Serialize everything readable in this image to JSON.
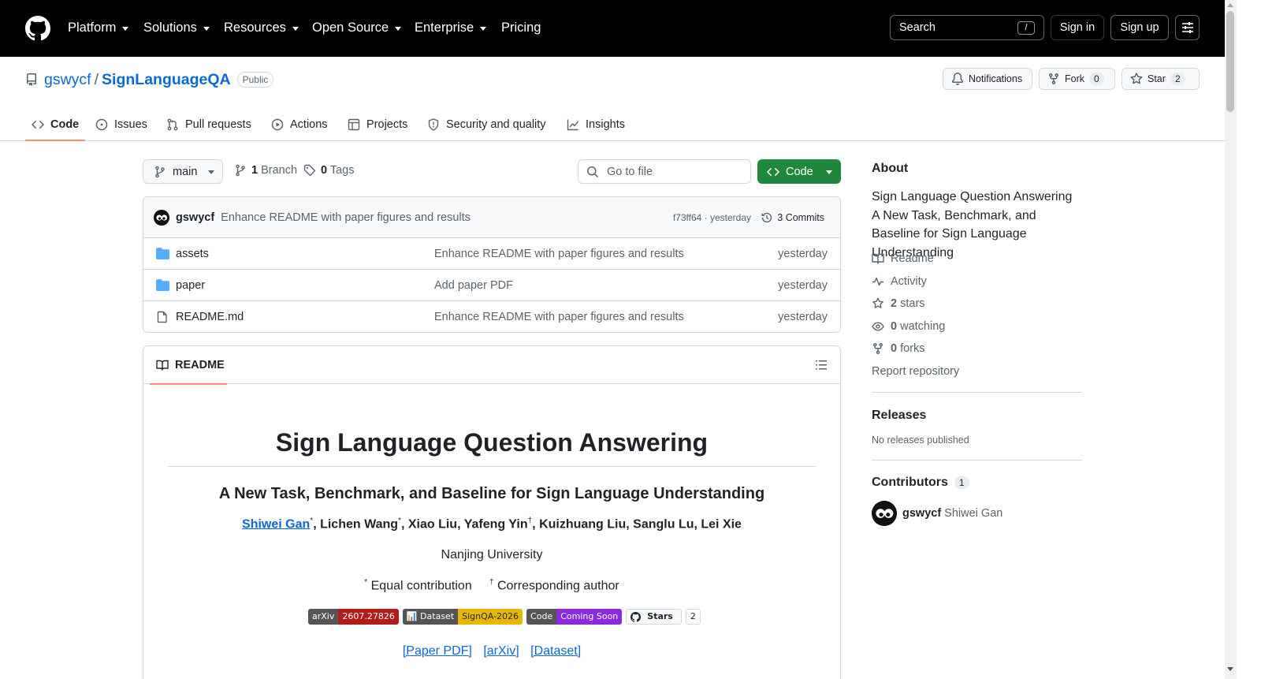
{
  "header": {
    "nav": [
      "Platform",
      "Solutions",
      "Resources",
      "Open Source",
      "Enterprise",
      "Pricing"
    ],
    "search_label": "Search",
    "search_key": "/",
    "sign_in": "Sign in",
    "sign_up": "Sign up"
  },
  "repo": {
    "owner": "gswycf",
    "separator": "/",
    "name": "SignLanguageQA",
    "visibility": "Public",
    "notifications_label": "Notifications",
    "fork_label": "Fork",
    "fork_count": "0",
    "star_label": "Star",
    "star_count": "2"
  },
  "tabs": [
    "Code",
    "Issues",
    "Pull requests",
    "Actions",
    "Projects",
    "Security and quality",
    "Insights"
  ],
  "toolbar": {
    "branch": "main",
    "branch_count": "1",
    "branch_label": "Branch",
    "tag_count": "0",
    "tag_label": "Tags",
    "goto_placeholder": "Go to file",
    "code_button": "Code"
  },
  "latest_commit": {
    "author": "gswycf",
    "message": "Enhance README with paper figures and results",
    "meta": "f73ff64 · yesterday",
    "commits": "3 Commits"
  },
  "files": [
    {
      "name": "assets",
      "type": "folder",
      "message": "Enhance README with paper figures and results",
      "date": "yesterday"
    },
    {
      "name": "paper",
      "type": "folder",
      "message": "Add paper PDF",
      "date": "yesterday"
    },
    {
      "name": "README.md",
      "type": "file",
      "message": "Enhance README with paper figures and results",
      "date": "yesterday"
    }
  ],
  "readme": {
    "tab_label": "README",
    "title": "Sign Language Question Answering",
    "subtitle": "A New Task, Benchmark, and Baseline for Sign Language Understanding",
    "authors": [
      {
        "name": "Shiwei Gan",
        "mark": "*",
        "link": true
      },
      {
        "name": "Lichen Wang",
        "mark": "*"
      },
      {
        "name": "Xiao Liu",
        "mark": ""
      },
      {
        "name": "Yafeng Yin",
        "mark": "†"
      },
      {
        "name": "Kuizhuang Liu",
        "mark": ""
      },
      {
        "name": "Sanglu Lu",
        "mark": ""
      },
      {
        "name": "Lei Xie",
        "mark": ""
      }
    ],
    "institution": "Nanjing University",
    "note_mark_1": "*",
    "note_text_1": "Equal contribution",
    "note_mark_2": "†",
    "note_text_2": "Corresponding author",
    "badges": [
      {
        "label": "arXiv",
        "value": "2607.27826",
        "color": "#b31b1b"
      },
      {
        "label": "📊 Dataset",
        "value": "SignQA-2026",
        "color": "#e6b800"
      },
      {
        "label": "Code",
        "value": "Coming Soon",
        "color": "#8a2be2"
      }
    ],
    "stars_badge_label": "Stars",
    "stars_badge_count": "2",
    "links": [
      "[Paper PDF]",
      "[arXiv]",
      "[Dataset]"
    ]
  },
  "sidebar": {
    "about_title": "About",
    "description": "Sign Language Question Answering A New Task, Benchmark, and Baseline for Sign Language Understanding",
    "readme": "Readme",
    "activity": "Activity",
    "stars_count": "2",
    "stars_label": "stars",
    "watching_count": "0",
    "watching_label": "watching",
    "forks_count": "0",
    "forks_label": "forks",
    "report": "Report repository",
    "releases_title": "Releases",
    "releases_text": "No releases published",
    "contributors_title": "Contributors",
    "contributors_count": "1",
    "contributor_login": "gswycf",
    "contributor_name": "Shiwei Gan"
  },
  "colors": {
    "accent": "#0969da",
    "green_button": "#1f883d",
    "tab_underline": "#fd8c73"
  }
}
